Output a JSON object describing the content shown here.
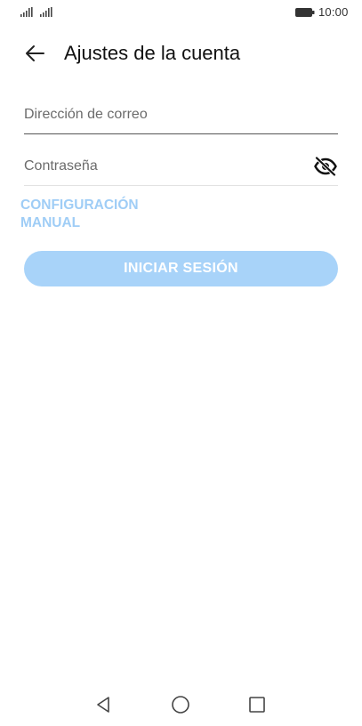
{
  "status_bar": {
    "time": "10:00",
    "icons": [
      "signal-icon",
      "signal-icon",
      "battery-icon"
    ]
  },
  "header": {
    "back_icon": "arrow-left-icon",
    "title": "Ajustes de la cuenta"
  },
  "form": {
    "email": {
      "value": "",
      "placeholder": "Dirección de correo"
    },
    "password": {
      "value": "",
      "placeholder": "Contraseña",
      "visibility_icon": "eye-slash-icon"
    },
    "manual_config_line1": "CONFIGURACIÓN",
    "manual_config_line2": "MANUAL",
    "signin_label": "INICIAR SESIÓN"
  },
  "colors": {
    "accent_light": "#9fcdf6",
    "button_bg": "#a8d3f9"
  },
  "nav_bar": {
    "icons": [
      "triangle-back-icon",
      "circle-home-icon",
      "square-recents-icon"
    ]
  }
}
